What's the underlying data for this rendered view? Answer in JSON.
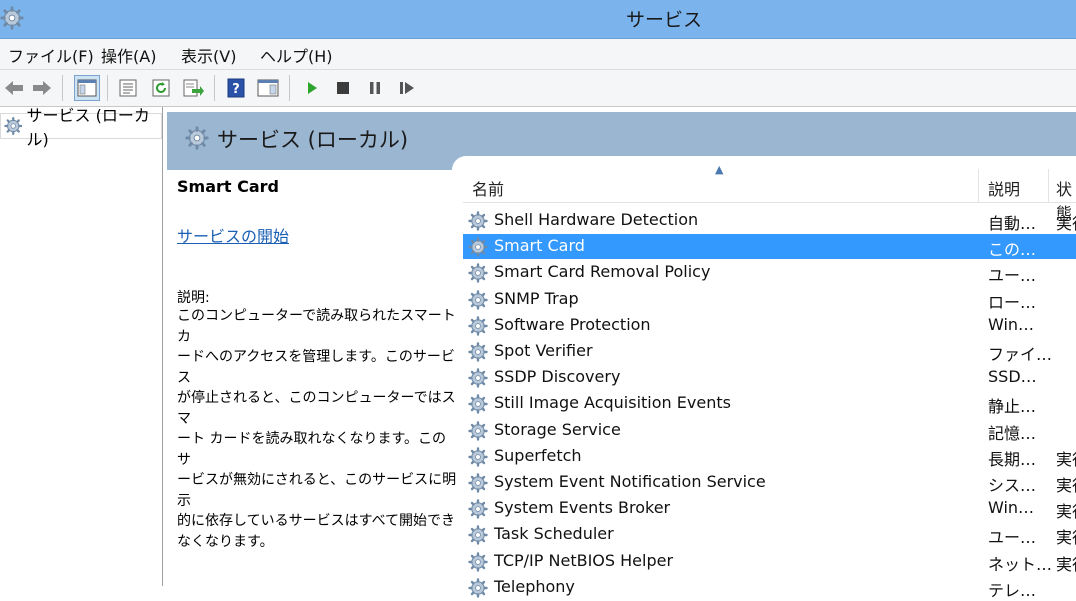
{
  "window": {
    "title": "サービス"
  },
  "menu": [
    "ファイル(F)",
    "操作(A)",
    "表示(V)",
    "ヘルプ(H)"
  ],
  "tree": {
    "root_label": "サービス (ローカル)"
  },
  "pane": {
    "banner_label": "サービス (ローカル)"
  },
  "details": {
    "service_name": "Smart Card",
    "start_link": "サービスの開始",
    "description_label": "説明:",
    "description_lines": [
      "このコンピューターで読み取られたスマート カ",
      "ードへのアクセスを管理します。このサービス",
      "が停止されると、このコンピューターではスマ",
      "ート カードを読み取れなくなります。このサ",
      "ービスが無効にされると、このサービスに明示",
      "的に依存しているサービスはすべて開始でき",
      "なくなります。"
    ]
  },
  "columns": {
    "name": "名前",
    "description": "説明",
    "status": "状態"
  },
  "services": [
    {
      "name": "Shell Hardware Detection",
      "description": "自動…",
      "status": "実行"
    },
    {
      "name": "Smart Card",
      "description": "この…",
      "status": "",
      "selected": true
    },
    {
      "name": "Smart Card Removal Policy",
      "description": "ユー…",
      "status": ""
    },
    {
      "name": "SNMP Trap",
      "description": "ロー…",
      "status": ""
    },
    {
      "name": "Software Protection",
      "description": "Win…",
      "status": ""
    },
    {
      "name": "Spot Verifier",
      "description": "ファイ…",
      "status": ""
    },
    {
      "name": "SSDP Discovery",
      "description": "SSD…",
      "status": ""
    },
    {
      "name": "Still Image Acquisition Events",
      "description": "静止…",
      "status": ""
    },
    {
      "name": "Storage Service",
      "description": "記憶…",
      "status": ""
    },
    {
      "name": "Superfetch",
      "description": "長期…",
      "status": "実行"
    },
    {
      "name": "System Event Notification Service",
      "description": "シス…",
      "status": "実行"
    },
    {
      "name": "System Events Broker",
      "description": "Win…",
      "status": "実行"
    },
    {
      "name": "Task Scheduler",
      "description": "ユー…",
      "status": "実行"
    },
    {
      "name": "TCP/IP NetBIOS Helper",
      "description": "ネット…",
      "status": "実行"
    },
    {
      "name": "Telephony",
      "description": "テレ…",
      "status": ""
    }
  ],
  "colors": {
    "titlebar": "#7bb4ec",
    "banner": "#9bb6d1",
    "selection": "#3399ff",
    "link": "#1a5fb4"
  },
  "icons": {
    "app": "services-gear-icon",
    "back": "back-arrow-icon",
    "forward": "forward-arrow-icon",
    "show_tree": "console-tree-icon",
    "properties": "properties-icon",
    "refresh": "refresh-icon",
    "export": "export-list-icon",
    "help": "help-icon",
    "action_pane": "action-pane-icon",
    "start": "play-icon",
    "stop": "stop-icon",
    "pause": "pause-icon",
    "resume": "resume-icon",
    "service": "service-gear-icon"
  }
}
